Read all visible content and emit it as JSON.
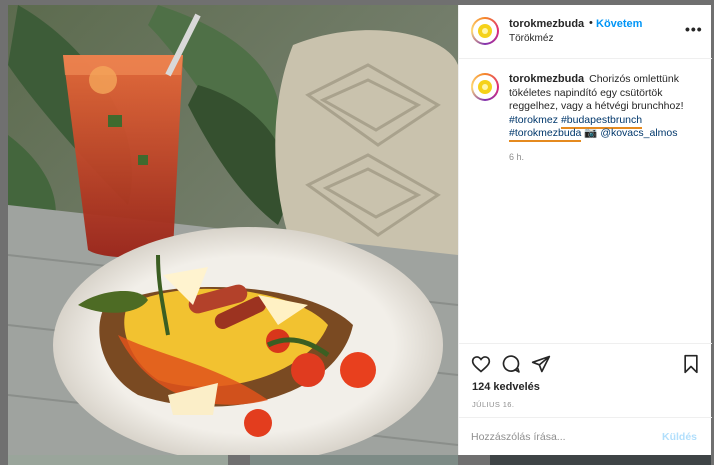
{
  "post": {
    "username": "torokmezbuda",
    "follow_separator": "•",
    "follow_label": "Követem",
    "location": "Törökméz",
    "more_label": "•••"
  },
  "caption": {
    "username": "torokmezbuda",
    "text": "Chorizós omlettünk tökéletes napindító egy csütörtök reggelhez, vagy a hétvégi brunchhoz!",
    "hashtag_1": "#torokmez",
    "hashtag_2": "#budapestbrunch",
    "hashtag_3": "#torokmezbuda",
    "camera_emoji": "📷",
    "mention": "@kovacs_almos",
    "time_ago": "6 h."
  },
  "engagement": {
    "likes": "124 kedvelés",
    "date": "JÚLIUS 16."
  },
  "comment_box": {
    "placeholder": "Hozzászólás írása...",
    "send_label": "Küldés"
  },
  "colors": {
    "link_blue": "#0095f6",
    "hashtag": "#00376b",
    "underline_accent": "#e58a1f",
    "send_disabled": "#b2dffc"
  },
  "icons": [
    "heart-icon",
    "comment-icon",
    "share-icon",
    "bookmark-icon",
    "more-options-icon"
  ]
}
